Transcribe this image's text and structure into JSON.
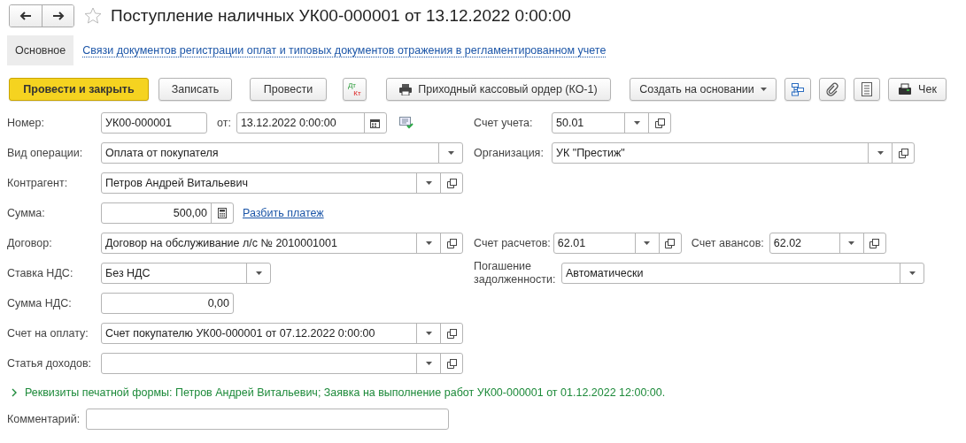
{
  "window": {
    "title": "Поступление наличных УК00-000001 от 13.12.2022 0:00:00",
    "favorite": false
  },
  "tabs": [
    {
      "label": "Основное",
      "selected": true,
      "kind": "tab"
    },
    {
      "label": "Связи документов регистрации оплат и типовых документов отражения в регламентированном учете",
      "selected": false,
      "kind": "link"
    }
  ],
  "toolbar": [
    {
      "kind": "primary",
      "label": "Провести и закрыть"
    },
    {
      "kind": "plain",
      "label": "Записать"
    },
    {
      "kind": "plain",
      "label": "Провести"
    },
    {
      "kind": "dtkt",
      "label": "Дт",
      "label2": "Кт"
    },
    {
      "kind": "print",
      "label": "Приходный кассовый ордер (КО-1)"
    },
    {
      "kind": "menu",
      "label": "Создать на основании"
    },
    {
      "kind": "structure"
    },
    {
      "kind": "attach"
    },
    {
      "kind": "list"
    },
    {
      "kind": "receipt",
      "label": "Чек"
    }
  ],
  "rows": [
    {
      "left": [
        {
          "label": "Номер:",
          "value": "УК00-000001",
          "kind": "text"
        },
        {
          "label": "от:",
          "value": "13.12.2022  0:00:00",
          "kind": "date"
        }
      ],
      "right": [
        {
          "label": "Счет учета:",
          "value": "50.01",
          "kind": "reference"
        }
      ]
    },
    {
      "left": [
        {
          "label": "Вид операции:",
          "value": "Оплата от покупателя",
          "kind": "select"
        }
      ],
      "right": [
        {
          "label": "Организация:",
          "value": "УК \"Престиж\"",
          "kind": "reference"
        }
      ]
    },
    {
      "left": [
        {
          "label": "Контрагент:",
          "value": "Петров Андрей Витальевич",
          "kind": "reference"
        }
      ],
      "right": []
    },
    {
      "left": [
        {
          "label": "Сумма:",
          "value": "500,00",
          "kind": "amount",
          "link": "Разбить платеж"
        }
      ],
      "right": []
    },
    {
      "left": [
        {
          "label": "Договор:",
          "value": "Договор на обслуживание л/с № 2010001001",
          "kind": "reference"
        }
      ],
      "right": [
        {
          "label": "Счет расчетов:",
          "value": "62.01",
          "kind": "reference"
        },
        {
          "label": "Счет авансов:",
          "value": "62.02",
          "kind": "reference"
        }
      ]
    },
    {
      "left": [
        {
          "label": "Ставка НДС:",
          "value": "Без НДС",
          "kind": "select"
        }
      ],
      "right": [
        {
          "label": "Погашение задолженности:",
          "value": "Автоматически",
          "kind": "select"
        }
      ]
    },
    {
      "left": [
        {
          "label": "Сумма НДС:",
          "value": "0,00",
          "kind": "number"
        }
      ],
      "right": []
    },
    {
      "left": [
        {
          "label": "Счет на оплату:",
          "value": "Счет покупателю УК00-000001 от 07.12.2022 0:00:00",
          "kind": "reference"
        }
      ],
      "right": []
    },
    {
      "left": [
        {
          "label": "Статья доходов:",
          "kind": "reference"
        }
      ],
      "right": []
    }
  ],
  "print_details": {
    "expanded": false,
    "text": "Реквизиты печатной формы: Петров Андрей Витальевич; Заявка на выполнение работ УК00-000001 от 01.12.2022 12:00:00."
  },
  "comment": {
    "label": "Комментарий:"
  }
}
